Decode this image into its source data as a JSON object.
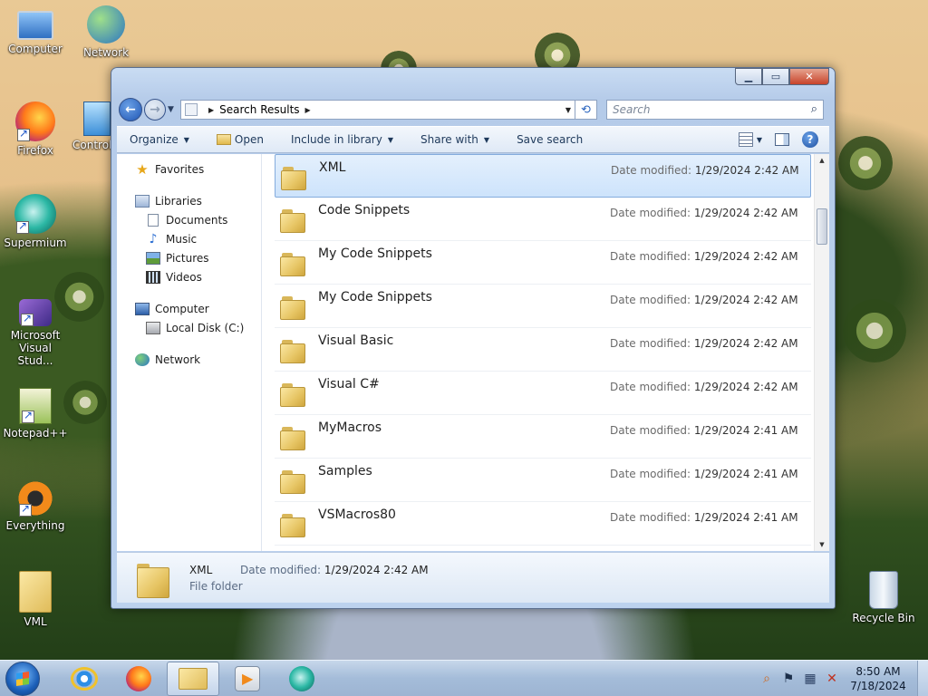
{
  "desktop": {
    "icons": [
      {
        "label": "Computer"
      },
      {
        "label": "Network"
      },
      {
        "label": "Firefox"
      },
      {
        "label": "Control"
      },
      {
        "label": "Supermium"
      },
      {
        "label": "Microsoft Visual Stud..."
      },
      {
        "label": "Notepad++"
      },
      {
        "label": "Everything"
      },
      {
        "label": "VML"
      },
      {
        "label": "Recycle Bin"
      }
    ]
  },
  "window": {
    "address": {
      "crumb": "Search Results"
    },
    "search_placeholder": "Search",
    "toolbar": {
      "organize": "Organize",
      "open": "Open",
      "include_in_library": "Include in library",
      "share_with": "Share with",
      "save_search": "Save search"
    },
    "nav_pane": {
      "favorites": "Favorites",
      "libraries": "Libraries",
      "documents": "Documents",
      "music": "Music",
      "pictures": "Pictures",
      "videos": "Videos",
      "computer": "Computer",
      "local_disk": "Local Disk (C:)",
      "network": "Network"
    },
    "modified_label": "Date modified:",
    "files": [
      {
        "name": "XML",
        "modified": "1/29/2024 2:42 AM"
      },
      {
        "name": "Code Snippets",
        "modified": "1/29/2024 2:42 AM"
      },
      {
        "name": "My Code Snippets",
        "modified": "1/29/2024 2:42 AM"
      },
      {
        "name": "My Code Snippets",
        "modified": "1/29/2024 2:42 AM"
      },
      {
        "name": "Visual Basic",
        "modified": "1/29/2024 2:42 AM"
      },
      {
        "name": "Visual C#",
        "modified": "1/29/2024 2:42 AM"
      },
      {
        "name": "MyMacros",
        "modified": "1/29/2024 2:41 AM"
      },
      {
        "name": "Samples",
        "modified": "1/29/2024 2:41 AM"
      },
      {
        "name": "VSMacros80",
        "modified": "1/29/2024 2:41 AM"
      }
    ],
    "details": {
      "name": "XML",
      "modified_label": "Date modified:",
      "modified": "1/29/2024 2:42 AM",
      "type": "File folder"
    }
  },
  "taskbar": {
    "time": "8:50 AM",
    "date": "7/18/2024"
  }
}
